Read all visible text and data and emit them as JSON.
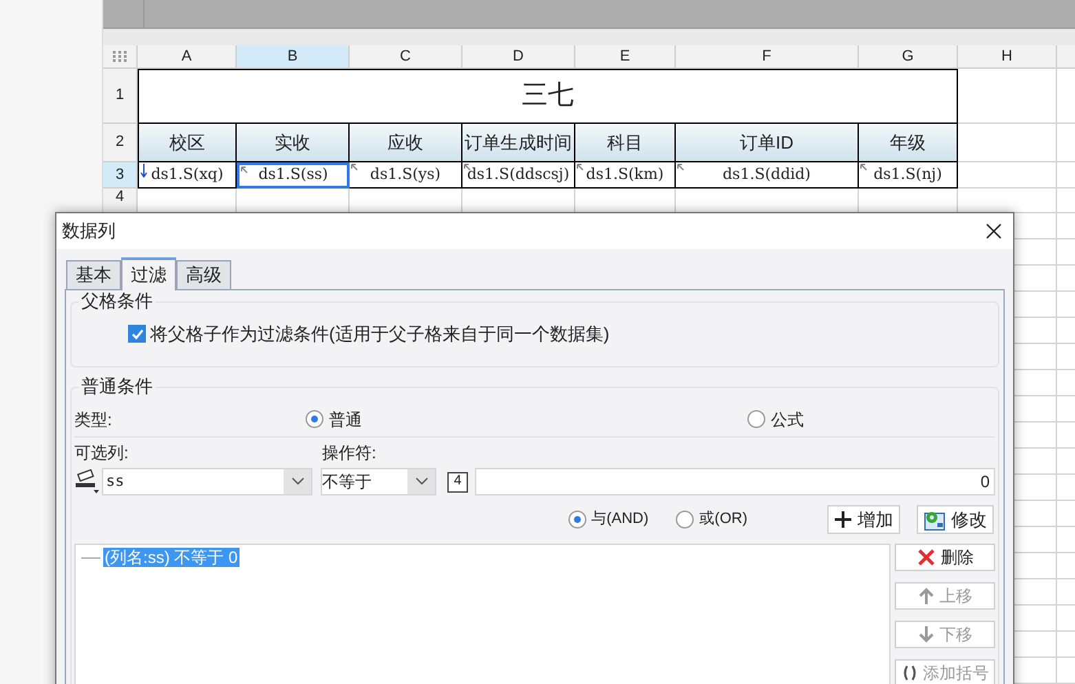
{
  "sheet": {
    "column_headers": [
      {
        "label": "A",
        "selected": false
      },
      {
        "label": "B",
        "selected": true
      },
      {
        "label": "C",
        "selected": false
      },
      {
        "label": "D",
        "selected": false
      },
      {
        "label": "E",
        "selected": false
      },
      {
        "label": "F",
        "selected": false
      },
      {
        "label": "G",
        "selected": false
      },
      {
        "label": "H",
        "selected": false
      }
    ],
    "row_headers": [
      {
        "label": "1",
        "selected": false
      },
      {
        "label": "2",
        "selected": false
      },
      {
        "label": "3",
        "selected": true
      },
      {
        "label": "4",
        "selected": false
      }
    ],
    "title": "三七",
    "headers": [
      "校区",
      "实收",
      "应收",
      "订单生成时间",
      "科目",
      "订单ID",
      "年级"
    ],
    "fields": [
      {
        "text": "ds1.S(xq)",
        "kind": "down",
        "selected": false
      },
      {
        "text": "ds1.S(ss)",
        "kind": "corner",
        "selected": true
      },
      {
        "text": "ds1.S(ys)",
        "kind": "corner",
        "selected": false
      },
      {
        "text": "ds1.S(ddscsj)",
        "kind": "corner",
        "selected": false
      },
      {
        "text": "ds1.S(km)",
        "kind": "corner",
        "selected": false
      },
      {
        "text": "ds1.S(ddid)",
        "kind": "corner",
        "selected": false
      },
      {
        "text": "ds1.S(nj)",
        "kind": "corner",
        "selected": false
      }
    ]
  },
  "dialog": {
    "title": "数据列",
    "tabs": [
      {
        "label": "基本",
        "selected": false
      },
      {
        "label": "过滤",
        "selected": true
      },
      {
        "label": "高级",
        "selected": false
      }
    ],
    "parent_group": {
      "legend": "父格条件",
      "checkbox": {
        "label": "将父格子作为过滤条件(适用于父子格来自于同一个数据集)",
        "checked": true
      }
    },
    "normal_group": {
      "legend": "普通条件",
      "type_label": "类型:",
      "type_options": [
        {
          "label": "普通",
          "selected": true
        },
        {
          "label": "公式",
          "selected": false
        }
      ],
      "column_label": "可选列:",
      "operator_label": "操作符:",
      "column_value": "ss",
      "operator_value": "不等于",
      "value_type_badge": "4",
      "value": "0",
      "logic_options": [
        {
          "label": "与(AND)",
          "selected": true
        },
        {
          "label": "或(OR)",
          "selected": false
        }
      ],
      "actions": [
        {
          "label": "增加",
          "kind": "add"
        },
        {
          "label": "修改",
          "kind": "edit"
        }
      ],
      "conditions": [
        {
          "text": "(列名:ss) 不等于 0",
          "selected": true
        }
      ],
      "side_buttons": [
        {
          "label": "删除",
          "kind": "delete",
          "disabled": false
        },
        {
          "label": "上移",
          "kind": "up",
          "disabled": true
        },
        {
          "label": "下移",
          "kind": "down",
          "disabled": true
        },
        {
          "label": "添加括号",
          "kind": "bracket",
          "disabled": true
        }
      ]
    }
  }
}
